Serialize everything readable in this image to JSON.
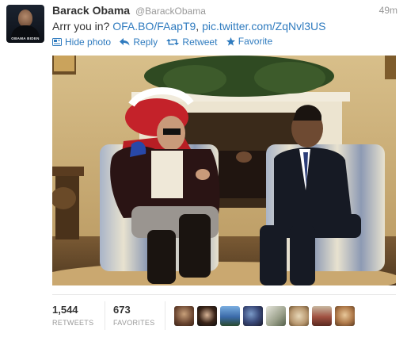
{
  "user": {
    "name": "Barack Obama",
    "handle": "@BarackObama",
    "avatar_caption": "OBAMA BIDEN"
  },
  "tweet": {
    "time": "49m",
    "text_prefix": "Arrr you in? ",
    "link1": "OFA.BO/FAapT9",
    "separator": ", ",
    "link2": "pic.twitter.com/ZqNvl3US"
  },
  "actions": {
    "hide_photo": "Hide photo",
    "reply": "Reply",
    "retweet": "Retweet",
    "favorite": "Favorite"
  },
  "stats": {
    "retweets_count": "1,544",
    "retweets_label": "RETWEETS",
    "favorites_count": "673",
    "favorites_label": "FAVORITES"
  },
  "colors": {
    "link": "#2f7bbf",
    "muted": "#999999",
    "text": "#333333"
  }
}
